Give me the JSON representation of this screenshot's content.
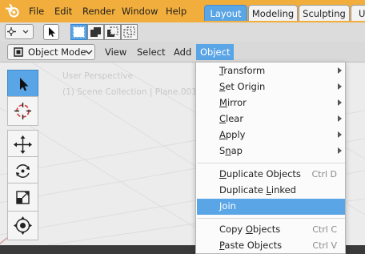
{
  "menubar": {
    "items": [
      "File",
      "Edit",
      "Render",
      "Window",
      "Help"
    ],
    "workspaces": [
      {
        "label": "Layout",
        "active": true
      },
      {
        "label": "Modeling",
        "active": false
      },
      {
        "label": "Sculpting",
        "active": false
      },
      {
        "label": "U",
        "active": false
      }
    ]
  },
  "header": {
    "mode": "Object Mode",
    "menus": [
      "View",
      "Select",
      "Add",
      "Object"
    ],
    "active_menu": "Object"
  },
  "viewport": {
    "perspective": "User Perspective",
    "collection": "(1) Scene Collection | Plane.001"
  },
  "toolbar": {
    "tools": [
      {
        "icon": "select-cursor-icon",
        "active": true
      },
      {
        "icon": "cursor-3d-icon",
        "active": false
      },
      {
        "icon": "move-icon",
        "active": false
      },
      {
        "icon": "rotate-icon",
        "active": false
      },
      {
        "icon": "scale-icon",
        "active": false
      },
      {
        "icon": "transform-icon",
        "active": false
      }
    ]
  },
  "object_menu": {
    "items": [
      {
        "pre": "",
        "u": "T",
        "post": "ransform",
        "submenu": true
      },
      {
        "pre": "",
        "u": "S",
        "post": "et Origin",
        "submenu": true
      },
      {
        "pre": "",
        "u": "M",
        "post": "irror",
        "submenu": true
      },
      {
        "pre": "",
        "u": "C",
        "post": "lear",
        "submenu": true
      },
      {
        "pre": "",
        "u": "A",
        "post": "pply",
        "submenu": true
      },
      {
        "pre": "S",
        "u": "n",
        "post": "ap",
        "submenu": true
      },
      {
        "pre": "",
        "u": "D",
        "post": "uplicate Objects",
        "shortcut": "Ctrl D"
      },
      {
        "pre": "Duplicate ",
        "u": "L",
        "post": "inked"
      },
      {
        "pre": "",
        "u": "J",
        "post": "oin",
        "highlighted": true
      },
      {
        "pre": "Copy ",
        "u": "O",
        "post": "bjects",
        "shortcut": "Ctrl C"
      },
      {
        "pre": "",
        "u": "P",
        "post": "aste Objects",
        "shortcut": "Ctrl V"
      }
    ]
  },
  "colors": {
    "topbar": "#f2ae3c",
    "accent": "#5aa5e6",
    "red_axis": "#d8a0a0"
  }
}
